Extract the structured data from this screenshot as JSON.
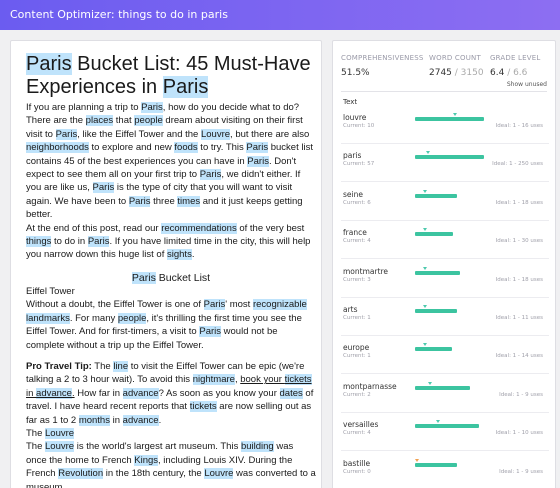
{
  "app": {
    "title": "Content Optimizer: things to do in paris"
  },
  "colors": {
    "topbar_start": "#6b5cf0",
    "topbar_end": "#8d6ef2",
    "highlight": "#bfe3fb",
    "bar_fill": "#3cc4a0",
    "marker_ok": "#4cc9ad",
    "marker_warn": "#f0a050"
  },
  "metrics": {
    "comprehensiveness": {
      "label": "COMPREHENSIVENESS",
      "value": "51.5%"
    },
    "word_count": {
      "label": "WORD COUNT",
      "value": "2745",
      "max": " / 3150"
    },
    "grade_level": {
      "label": "GRADE LEVEL",
      "value": "6.4",
      "max": " / 6.6"
    },
    "show_unused": "Show unused"
  },
  "terms_header": "Text",
  "terms": [
    {
      "name": "louvre",
      "current": "Current: 10",
      "ideal": "Ideal: 1 - 16 uses",
      "fill": 0.56,
      "marker": 0.31,
      "status": "ok"
    },
    {
      "name": "paris",
      "current": "Current: 57",
      "ideal": "Ideal: 1 - 250 uses",
      "fill": 0.56,
      "marker": 0.09,
      "status": "ok"
    },
    {
      "name": "seine",
      "current": "Current: 6",
      "ideal": "Ideal: 1 - 18 uses",
      "fill": 0.34,
      "marker": 0.07,
      "status": "ok"
    },
    {
      "name": "france",
      "current": "Current: 4",
      "ideal": "Ideal: 1 - 30 uses",
      "fill": 0.31,
      "marker": 0.07,
      "status": "ok"
    },
    {
      "name": "montmartre",
      "current": "Current: 3",
      "ideal": "Ideal: 1 - 18 uses",
      "fill": 0.36,
      "marker": 0.07,
      "status": "ok"
    },
    {
      "name": "arts",
      "current": "Current: 1",
      "ideal": "Ideal: 1 - 11 uses",
      "fill": 0.34,
      "marker": 0.07,
      "status": "ok"
    },
    {
      "name": "europe",
      "current": "Current: 1",
      "ideal": "Ideal: 1 - 14 uses",
      "fill": 0.3,
      "marker": 0.07,
      "status": "ok"
    },
    {
      "name": "montparnasse",
      "current": "Current: 2",
      "ideal": "Ideal: 1 - 9 uses",
      "fill": 0.44,
      "marker": 0.11,
      "status": "ok"
    },
    {
      "name": "versailles",
      "current": "Current: 4",
      "ideal": "Ideal: 1 - 10 uses",
      "fill": 0.52,
      "marker": 0.17,
      "status": "ok"
    },
    {
      "name": "bastille",
      "current": "Current: 0",
      "ideal": "Ideal: 1 - 9 uses",
      "fill": 0.34,
      "marker": 0.0,
      "status": "warn"
    }
  ],
  "doc": {
    "title_parts": [
      {
        "text": "Paris",
        "hl": true
      },
      {
        "text": " Bucket List: 45 Must-Have Experiences in "
      },
      {
        "text": "Paris",
        "hl": true
      }
    ],
    "p1": [
      {
        "text": "If you are planning a trip to "
      },
      {
        "text": "Paris",
        "hl": true
      },
      {
        "text": ", how do you decide what to do? There are the "
      },
      {
        "text": "places",
        "hl": true
      },
      {
        "text": " that "
      },
      {
        "text": "people",
        "hl": true
      },
      {
        "text": " dream about visiting on their first visit to "
      },
      {
        "text": "Paris",
        "hl": true
      },
      {
        "text": ", like the Eiffel Tower and the "
      },
      {
        "text": "Louvre",
        "hl": true
      },
      {
        "text": ", but there are also "
      },
      {
        "text": "neighborhoods",
        "hl": true
      },
      {
        "text": " to explore and new "
      },
      {
        "text": "foods",
        "hl": true
      },
      {
        "text": " to try. This "
      },
      {
        "text": "Paris",
        "hl": true
      },
      {
        "text": " bucket list contains 45 of the best experiences you can have in "
      },
      {
        "text": "Paris",
        "hl": true
      },
      {
        "text": ". Don't expect to see them all on your first trip to "
      },
      {
        "text": "Paris",
        "hl": true
      },
      {
        "text": ", we didn't either. If you are like us, "
      },
      {
        "text": "Paris",
        "hl": true
      },
      {
        "text": " is the type of city that you will want to visit again. We have been to "
      },
      {
        "text": "Paris",
        "hl": true
      },
      {
        "text": " three "
      },
      {
        "text": "times",
        "hl": true
      },
      {
        "text": " and it just keeps getting better."
      }
    ],
    "p2": [
      {
        "text": "At the end of this post, read our "
      },
      {
        "text": "recommendations",
        "hl": true
      },
      {
        "text": " of the very best "
      },
      {
        "text": "things",
        "hl": true
      },
      {
        "text": " to do in "
      },
      {
        "text": "Paris",
        "hl": true
      },
      {
        "text": ". If you have limited time in the city, this will help you narrow down this huge list of "
      },
      {
        "text": "sights",
        "hl": true
      },
      {
        "text": "."
      }
    ],
    "subheading": [
      {
        "text": "Paris",
        "hl": true
      },
      {
        "text": " Bucket List"
      }
    ],
    "eiffel_heading": "Eiffel Tower",
    "p3": [
      {
        "text": "Without a doubt, the Eiffel Tower is one of "
      },
      {
        "text": "Paris",
        "hl": true
      },
      {
        "text": "' most "
      },
      {
        "text": "recognizable",
        "hl": true
      },
      {
        "text": " "
      },
      {
        "text": "landmarks",
        "hl": true
      },
      {
        "text": ". For many "
      },
      {
        "text": "people",
        "hl": true
      },
      {
        "text": ", it's thrilling the first time you see the Eiffel Tower. And for first-timers, a visit to "
      },
      {
        "text": "Paris",
        "hl": true
      },
      {
        "text": " would not be complete without a trip up the Eiffel Tower."
      }
    ],
    "p4": [
      {
        "text": "Pro Travel Tip:",
        "b": true
      },
      {
        "text": " The "
      },
      {
        "text": "line",
        "hl": true
      },
      {
        "text": " to visit the Eiffel Tower can be epic (we're talking a 2 to 3 hour wait). To avoid this "
      },
      {
        "text": "nightmare",
        "hl": true
      },
      {
        "text": ", "
      },
      {
        "text": "book your ",
        "u": true
      },
      {
        "text": "tickets",
        "hl": true,
        "u": true
      },
      {
        "text": " in ",
        "u": true
      },
      {
        "text": "advance",
        "hl": true,
        "u": true
      },
      {
        "text": ".",
        "u": true
      },
      {
        "text": " How far in "
      },
      {
        "text": "advance",
        "hl": true
      },
      {
        "text": "? As soon as you know your "
      },
      {
        "text": "dates",
        "hl": true
      },
      {
        "text": " of travel. I have heard recent reports that "
      },
      {
        "text": "tickets",
        "hl": true
      },
      {
        "text": " are now selling out as far as 1 to 2 "
      },
      {
        "text": "months",
        "hl": true
      },
      {
        "text": " in "
      },
      {
        "text": "advance",
        "hl": true
      },
      {
        "text": "."
      }
    ],
    "louvre_heading": [
      {
        "text": "The "
      },
      {
        "text": "Louvre",
        "hl": true
      }
    ],
    "p5": [
      {
        "text": "The "
      },
      {
        "text": "Louvre",
        "hl": true
      },
      {
        "text": " is the world's largest art museum. This "
      },
      {
        "text": "building",
        "hl": true
      },
      {
        "text": " was once the home to French "
      },
      {
        "text": "Kings",
        "hl": true
      },
      {
        "text": ", including Louis XIV. During the French "
      },
      {
        "text": "Revolution",
        "hl": true
      },
      {
        "text": " in the 18th century, the "
      },
      {
        "text": "Louvre",
        "hl": true
      },
      {
        "text": " was converted to a museum."
      }
    ]
  }
}
